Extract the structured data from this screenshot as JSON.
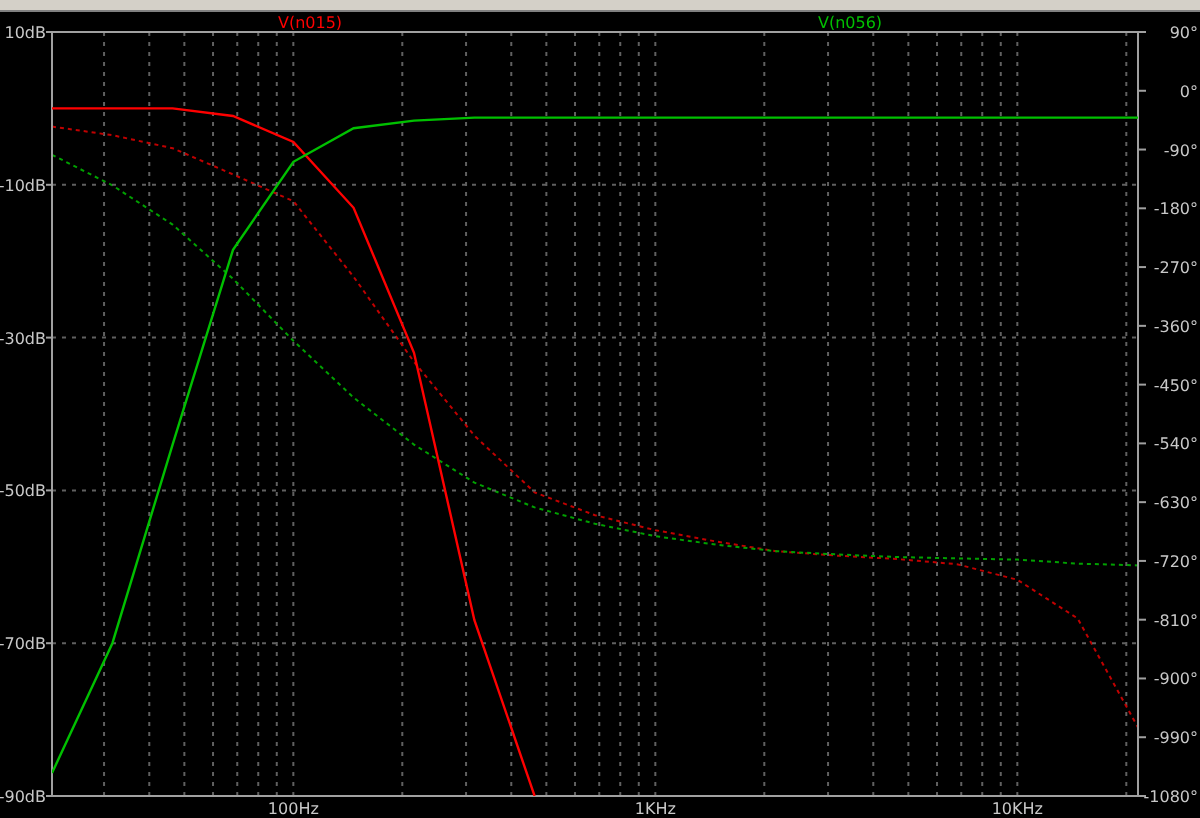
{
  "plot": {
    "chart_data": {
      "type": "line",
      "categories": [
        null,
        null,
        null,
        null,
        "100Hz",
        null,
        null,
        null,
        null,
        null,
        "1KHz",
        null,
        null,
        null,
        null,
        null,
        "10KHz",
        null,
        null
      ],
      "ylim": [
        -90,
        10
      ],
      "grid": true,
      "yticks": [
        {
          "value": 10,
          "label": "10dB"
        },
        {
          "value": -10,
          "label": "-10dB"
        },
        {
          "value": -30,
          "label": "-30dB"
        },
        {
          "value": -50,
          "label": "-50dB"
        },
        {
          "value": -70,
          "label": "-70dB"
        },
        {
          "value": -90,
          "label": "-90dB"
        }
      ],
      "series": [
        {
          "name": "V(n015)",
          "color": "#ff0000",
          "values": [
            0,
            0,
            0,
            -1,
            -4.4,
            -13,
            -32,
            -67,
            -90,
            null,
            null,
            null,
            null,
            null,
            null,
            null,
            null,
            null,
            null
          ]
        },
        {
          "name": "V(n056)",
          "color": "#00c000",
          "values": [
            -87,
            -70,
            -44,
            -18.5,
            -7,
            -2.6,
            -1.6,
            -1.2,
            -1.2,
            -1.2,
            -1.2,
            -1.2,
            -1.2,
            -1.2,
            -1.2,
            -1.2,
            -1.2,
            -1.2,
            -1.2
          ]
        }
      ]
    }
  },
  "phase_plot": {
    "chart_data": {
      "type": "line",
      "categories": [
        null,
        null,
        null,
        null,
        null,
        null,
        null,
        null,
        null,
        null,
        null,
        null,
        null,
        null,
        null,
        null,
        null,
        null,
        null
      ],
      "ylim": [
        -1080,
        90
      ],
      "yticks": [
        {
          "value": 90,
          "label": "90°"
        },
        {
          "value": 0,
          "label": "0°"
        },
        {
          "value": -90,
          "label": "-90°"
        },
        {
          "value": -180,
          "label": "-180°"
        },
        {
          "value": -270,
          "label": "-270°"
        },
        {
          "value": -360,
          "label": "-360°"
        },
        {
          "value": -450,
          "label": "-450°"
        },
        {
          "value": -540,
          "label": "-540°"
        },
        {
          "value": -630,
          "label": "-630°"
        },
        {
          "value": -720,
          "label": "-720°"
        },
        {
          "value": -810,
          "label": "-810°"
        },
        {
          "value": -900,
          "label": "-900°"
        },
        {
          "value": -990,
          "label": "-990°"
        },
        {
          "value": -1080,
          "label": "-1080°"
        }
      ],
      "series": [
        {
          "color": "#c00000",
          "line_style": "dashed",
          "values": [
            -55,
            -68,
            -88,
            -128,
            -169,
            -285,
            -415,
            -528,
            -615,
            -650,
            -673,
            -690,
            -705,
            -712,
            -717,
            -725,
            -749,
            -808,
            -975
          ]
        },
        {
          "color": "#00a000",
          "line_style": "dashed",
          "values": [
            -98,
            -145,
            -205,
            -288,
            -383,
            -470,
            -542,
            -600,
            -638,
            -663,
            -682,
            -695,
            -705,
            -710,
            -714,
            -716,
            -718,
            -724,
            -727
          ]
        }
      ]
    }
  }
}
